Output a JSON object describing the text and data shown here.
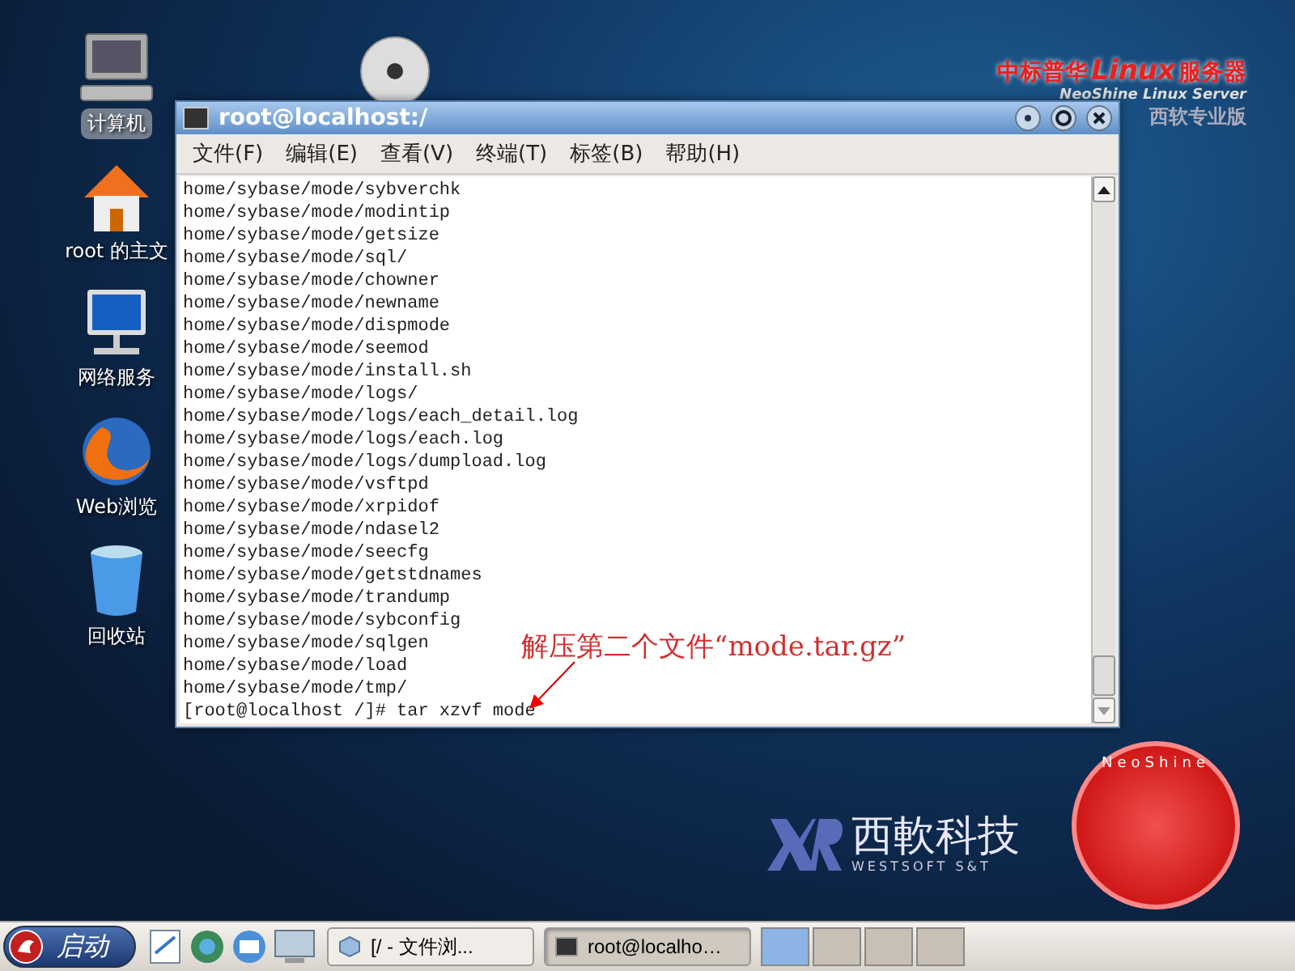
{
  "desktop_icons": [
    {
      "kind": "computer",
      "label": "计算机"
    },
    {
      "kind": "home",
      "label": "root 的主文"
    },
    {
      "kind": "network",
      "label": "网络服务"
    },
    {
      "kind": "browser",
      "label": "Web浏览"
    },
    {
      "kind": "trash",
      "label": "回收站"
    }
  ],
  "wallpaper": {
    "brand_cn": "中标普华",
    "brand_linux": "Linux",
    "brand_server": "服务器",
    "brand_en": "NeoShine Linux Server",
    "edition": "西软专业版",
    "company_cn": "西軟科技",
    "company_en": "WESTSOFT S&T",
    "seal_text": "NeoShine"
  },
  "terminal": {
    "title": "root@localhost:/",
    "menu": [
      "文件(F)",
      "编辑(E)",
      "查看(V)",
      "终端(T)",
      "标签(B)",
      "帮助(H)"
    ],
    "lines": [
      "home/sybase/mode/sybverchk",
      "home/sybase/mode/modintip",
      "home/sybase/mode/getsize",
      "home/sybase/mode/sql/",
      "home/sybase/mode/chowner",
      "home/sybase/mode/newname",
      "home/sybase/mode/dispmode",
      "home/sybase/mode/seemod",
      "home/sybase/mode/install.sh",
      "home/sybase/mode/logs/",
      "home/sybase/mode/logs/each_detail.log",
      "home/sybase/mode/logs/each.log",
      "home/sybase/mode/logs/dumpload.log",
      "home/sybase/mode/vsftpd",
      "home/sybase/mode/xrpidof",
      "home/sybase/mode/ndasel2",
      "home/sybase/mode/seecfg",
      "home/sybase/mode/getstdnames",
      "home/sybase/mode/trandump",
      "home/sybase/mode/sybconfig",
      "home/sybase/mode/sqlgen",
      "home/sybase/mode/load",
      "home/sybase/mode/tmp/",
      "[root@localhost /]# tar xzvf mode"
    ]
  },
  "annotation": "解压第二个文件“mode.tar.gz”",
  "taskbar": {
    "start": "启动",
    "tasks": [
      {
        "label": "[/ - 文件浏...",
        "kind": "folder",
        "selected": false
      },
      {
        "label": "root@localho…",
        "kind": "terminal",
        "selected": true
      }
    ],
    "workspaces": [
      {
        "selected": true
      },
      {
        "selected": false
      },
      {
        "selected": false
      },
      {
        "selected": false
      }
    ]
  }
}
